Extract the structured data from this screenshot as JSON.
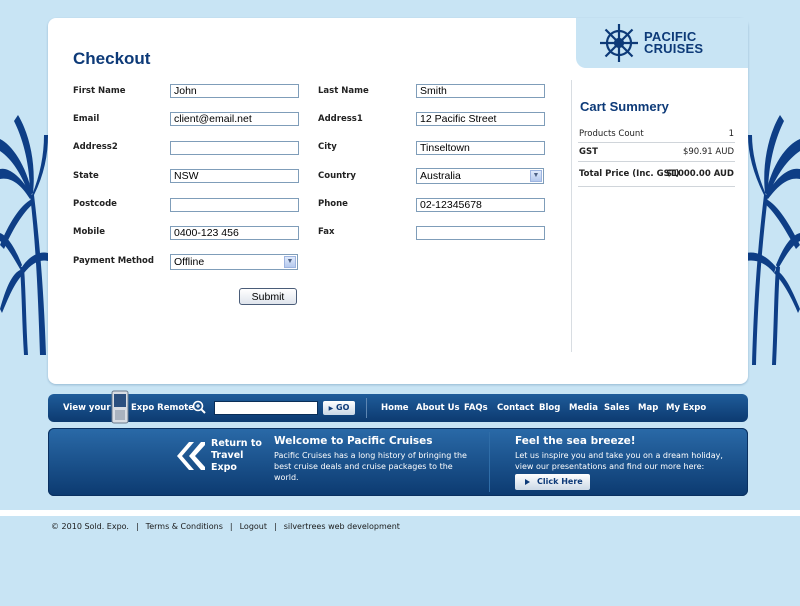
{
  "brand": {
    "line1": "PACIFIC",
    "line2": "CRUISES"
  },
  "page_title": "Checkout",
  "form": {
    "first_name": {
      "label": "First Name",
      "value": "John"
    },
    "last_name": {
      "label": "Last Name",
      "value": "Smith"
    },
    "email": {
      "label": "Email",
      "value": "client@email.net"
    },
    "address1": {
      "label": "Address1",
      "value": "12 Pacific Street"
    },
    "address2": {
      "label": "Address2",
      "value": ""
    },
    "city": {
      "label": "City",
      "value": "Tinseltown"
    },
    "state": {
      "label": "State",
      "value": "NSW"
    },
    "country": {
      "label": "Country",
      "value": "Australia"
    },
    "postcode": {
      "label": "Postcode",
      "value": ""
    },
    "phone": {
      "label": "Phone",
      "value": "02-12345678"
    },
    "mobile": {
      "label": "Mobile",
      "value": "0400-123 456"
    },
    "fax": {
      "label": "Fax",
      "value": ""
    },
    "payment_method": {
      "label": "Payment Method",
      "value": "Offline"
    },
    "submit_label": "Submit"
  },
  "cart": {
    "title": "Cart Summery",
    "rows": [
      {
        "label": "Products Count",
        "value": "1"
      },
      {
        "label": "GST",
        "value": "$90.91 AUD"
      },
      {
        "label": "Total Price (Inc. GST)",
        "value": "$1000.00 AUD"
      }
    ]
  },
  "nav": {
    "view_your": "View your",
    "expo_remote": "Expo Remote",
    "search_placeholder": "",
    "go_label": "GO",
    "links": [
      "Home",
      "About Us",
      "FAQs",
      "Contact",
      "Blog",
      "Media",
      "Sales",
      "Map",
      "My Expo"
    ]
  },
  "promo": {
    "return_lines": [
      "Return to",
      "Travel",
      "Expo"
    ],
    "welcome_title": "Welcome to Pacific Cruises",
    "welcome_body": [
      "Pacific Cruises has a long history of bringing the",
      "best cruise deals and cruise packages to the",
      "world."
    ],
    "breeze_title": "Feel the sea breeze!",
    "breeze_body": [
      "Let us inspire you and take you on a dream holiday,",
      "view our presentations and find our more here:"
    ],
    "click_label": "Click Here"
  },
  "footer": {
    "copyright": "© 2010 Sold. Expo.",
    "links": [
      "Terms & Conditions",
      "Logout",
      "silvertrees web development"
    ]
  },
  "colors": {
    "brand_navy": "#0d3a78",
    "background": "#c8e4f4",
    "navbar": "#0c3a70"
  }
}
